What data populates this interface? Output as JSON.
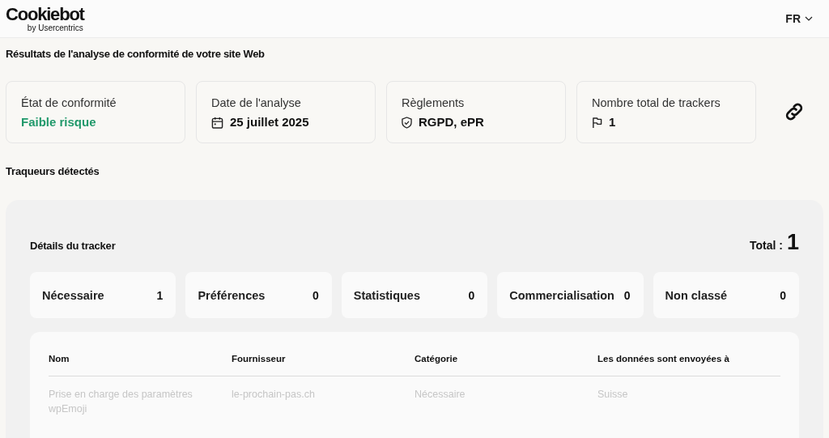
{
  "header": {
    "logo": {
      "name": "Cookiebot",
      "tagline": "by Usercentrics"
    },
    "language": "FR"
  },
  "title": "Résultats de l'analyse de conformité de votre site Web",
  "summary_cards": [
    {
      "kind": "status",
      "label": "État de conformité",
      "value": "Faible risque"
    },
    {
      "kind": "date",
      "label": "Date de l'analyse",
      "value": "25 juillet 2025"
    },
    {
      "kind": "regulations",
      "label": "Règlements",
      "value": "RGPD, ePR"
    },
    {
      "kind": "count",
      "label": "Nombre total de trackers",
      "value": "1"
    }
  ],
  "section_title": "Traqueurs détectés",
  "tracker_panel": {
    "title": "Détails du tracker",
    "total_label": "Total :",
    "total": "1",
    "categories": [
      {
        "label": "Nécessaire",
        "count": "1"
      },
      {
        "label": "Préférences",
        "count": "0"
      },
      {
        "label": "Statistiques",
        "count": "0"
      },
      {
        "label": "Commercialisation",
        "count": "0"
      },
      {
        "label": "Non classé",
        "count": "0"
      }
    ],
    "table": {
      "columns": [
        "Nom",
        "Fournisseur",
        "Catégorie",
        "Les données sont envoyées à"
      ],
      "rows": [
        [
          "Prise en charge des paramètres wpEmoji",
          "le-prochain-pas.ch",
          "Nécessaire",
          "Suisse"
        ]
      ]
    }
  }
}
